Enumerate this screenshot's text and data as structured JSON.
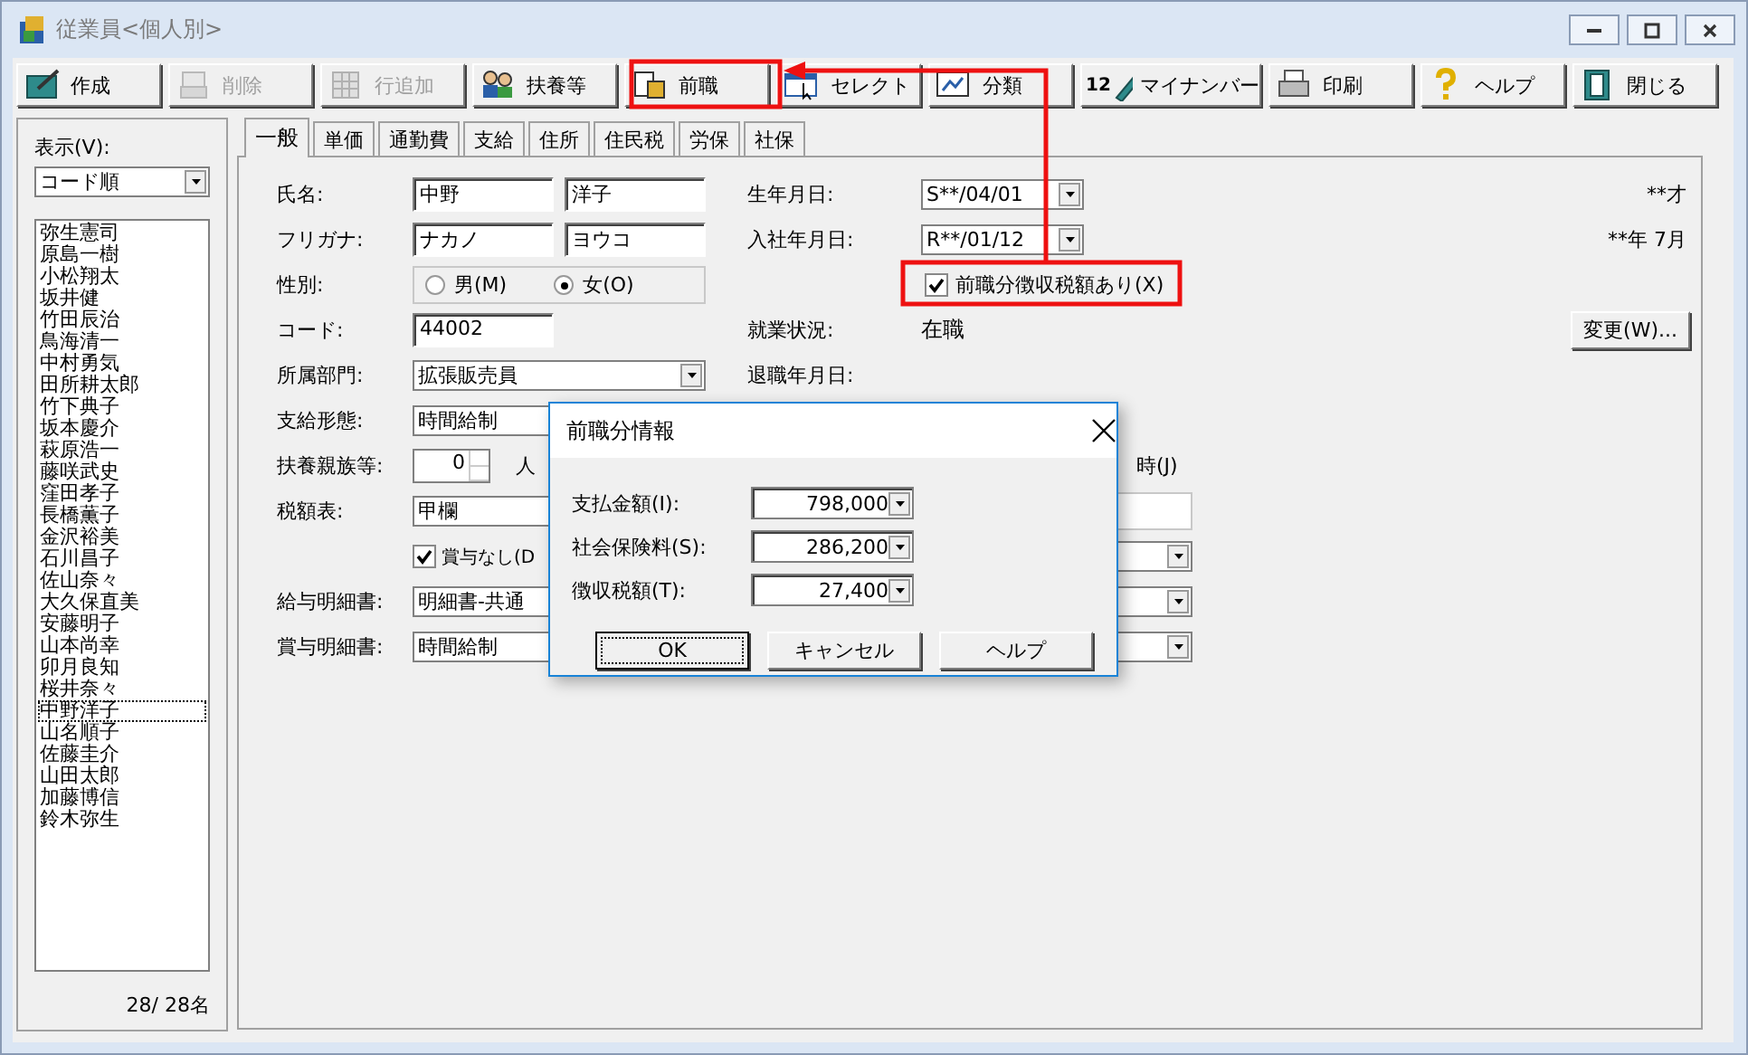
{
  "window": {
    "title": "従業員<個人別>"
  },
  "toolbar": [
    {
      "label": "作成",
      "disabled": false
    },
    {
      "label": "削除",
      "disabled": true
    },
    {
      "label": "行追加",
      "disabled": true
    },
    {
      "label": "扶養等",
      "disabled": false
    },
    {
      "label": "前職",
      "disabled": false
    },
    {
      "label": "セレクト",
      "disabled": false
    },
    {
      "label": "分類",
      "disabled": false
    },
    {
      "label": "マイナンバー",
      "disabled": false,
      "icon_text": "12"
    },
    {
      "label": "印刷",
      "disabled": false
    },
    {
      "label": "ヘルプ",
      "disabled": false
    },
    {
      "label": "閉じる",
      "disabled": false
    }
  ],
  "sidebar": {
    "view_label": "表示(V):",
    "sort": "コード順",
    "employees": [
      {
        "name": "弥生憲司",
        "selected": false
      },
      {
        "name": "原島一樹",
        "selected": false
      },
      {
        "name": "小松翔太",
        "selected": false
      },
      {
        "name": "坂井健",
        "selected": false
      },
      {
        "name": "竹田辰治",
        "selected": false
      },
      {
        "name": "鳥海清一",
        "selected": false
      },
      {
        "name": "中村勇気",
        "selected": false
      },
      {
        "name": "田所耕太郎",
        "selected": false
      },
      {
        "name": "竹下典子",
        "selected": false
      },
      {
        "name": "坂本慶介",
        "selected": false
      },
      {
        "name": "萩原浩一",
        "selected": false
      },
      {
        "name": "藤咲武史",
        "selected": false
      },
      {
        "name": "窪田孝子",
        "selected": false
      },
      {
        "name": "長橋薫子",
        "selected": false
      },
      {
        "name": "金沢裕美",
        "selected": false
      },
      {
        "name": "石川昌子",
        "selected": false
      },
      {
        "name": "佐山奈々",
        "selected": false
      },
      {
        "name": "大久保直美",
        "selected": false
      },
      {
        "name": "安藤明子",
        "selected": false
      },
      {
        "name": "山本尚幸",
        "selected": false
      },
      {
        "name": "卯月良知",
        "selected": false
      },
      {
        "name": "桜井奈々",
        "selected": false
      },
      {
        "name": "中野洋子",
        "selected": true
      },
      {
        "name": "山名順子",
        "selected": false
      },
      {
        "name": "佐藤圭介",
        "selected": false
      },
      {
        "name": "山田太郎",
        "selected": false
      },
      {
        "name": "加藤博信",
        "selected": false
      },
      {
        "name": "鈴木弥生",
        "selected": false
      }
    ],
    "count": "28/ 28名"
  },
  "tabs": [
    {
      "label": "一般",
      "selected": true
    },
    {
      "label": "単価",
      "selected": false
    },
    {
      "label": "通勤費",
      "selected": false
    },
    {
      "label": "支給",
      "selected": false
    },
    {
      "label": "住所",
      "selected": false
    },
    {
      "label": "住民税",
      "selected": false
    },
    {
      "label": "労保",
      "selected": false
    },
    {
      "label": "社保",
      "selected": false
    }
  ],
  "form": {
    "rows": [
      {
        "kind": "text_pair",
        "label": "氏名:",
        "values": [
          "中野",
          "洋子"
        ],
        "right": {
          "kind": "date",
          "label": "生年月日:",
          "value": "S**/04/01",
          "note": "**才"
        }
      },
      {
        "kind": "text_pair",
        "label": "フリガナ:",
        "values": [
          "ナカノ",
          "ヨウコ"
        ],
        "right": {
          "kind": "date",
          "label": "入社年月日:",
          "value": "R**/01/12",
          "note": "**年 7月"
        }
      },
      {
        "kind": "radio",
        "label": "性別:",
        "options": [
          {
            "label": "男(M)",
            "selected": false
          },
          {
            "label": "女(O)",
            "selected": true
          }
        ],
        "right": {
          "kind": "checkbox",
          "label": "前職分徴収税額あり(X)",
          "checked": true
        }
      },
      {
        "kind": "text",
        "label": "コード:",
        "value": "44002",
        "right": {
          "kind": "status",
          "label": "就業状況:",
          "value": "在職",
          "button": "変更(W)..."
        }
      },
      {
        "kind": "dropdown",
        "label": "所属部門:",
        "value": "拡張販売員",
        "right": {
          "kind": "label",
          "label": "退職年月日:"
        }
      },
      {
        "kind": "wide_dropdown",
        "label": "支給形態:",
        "value": "時間給制"
      },
      {
        "kind": "spinner",
        "label": "扶養親族等:",
        "value": "0",
        "unit": "人",
        "right": {
          "kind": "text",
          "value": "時(J)"
        }
      },
      {
        "kind": "short_dropdown",
        "label": "税額表:",
        "value": "甲欄",
        "right": {
          "kind": "field"
        }
      },
      {
        "kind": "checkbox",
        "value": "賞与なし(D",
        "checked": true,
        "right": {
          "kind": "dropdown"
        }
      },
      {
        "kind": "dropdown",
        "label": "給与明細書:",
        "value": "明細書-共通",
        "right": {
          "kind": "dropdown"
        }
      },
      {
        "kind": "dropdown",
        "label": "賞与明細書:",
        "value": "時間給制",
        "right": {
          "kind": "dropdown"
        }
      }
    ]
  },
  "dialog": {
    "title": "前職分情報",
    "fields": [
      {
        "label": "支払金額(I):",
        "value": "798,000"
      },
      {
        "label": "社会保険料(S):",
        "value": "286,200"
      },
      {
        "label": "徴収税額(T):",
        "value": "27,400"
      }
    ],
    "buttons": [
      {
        "label": "OK",
        "focused": true
      },
      {
        "label": "キャンセル",
        "focused": false
      },
      {
        "label": "ヘルプ",
        "focused": false
      }
    ]
  }
}
